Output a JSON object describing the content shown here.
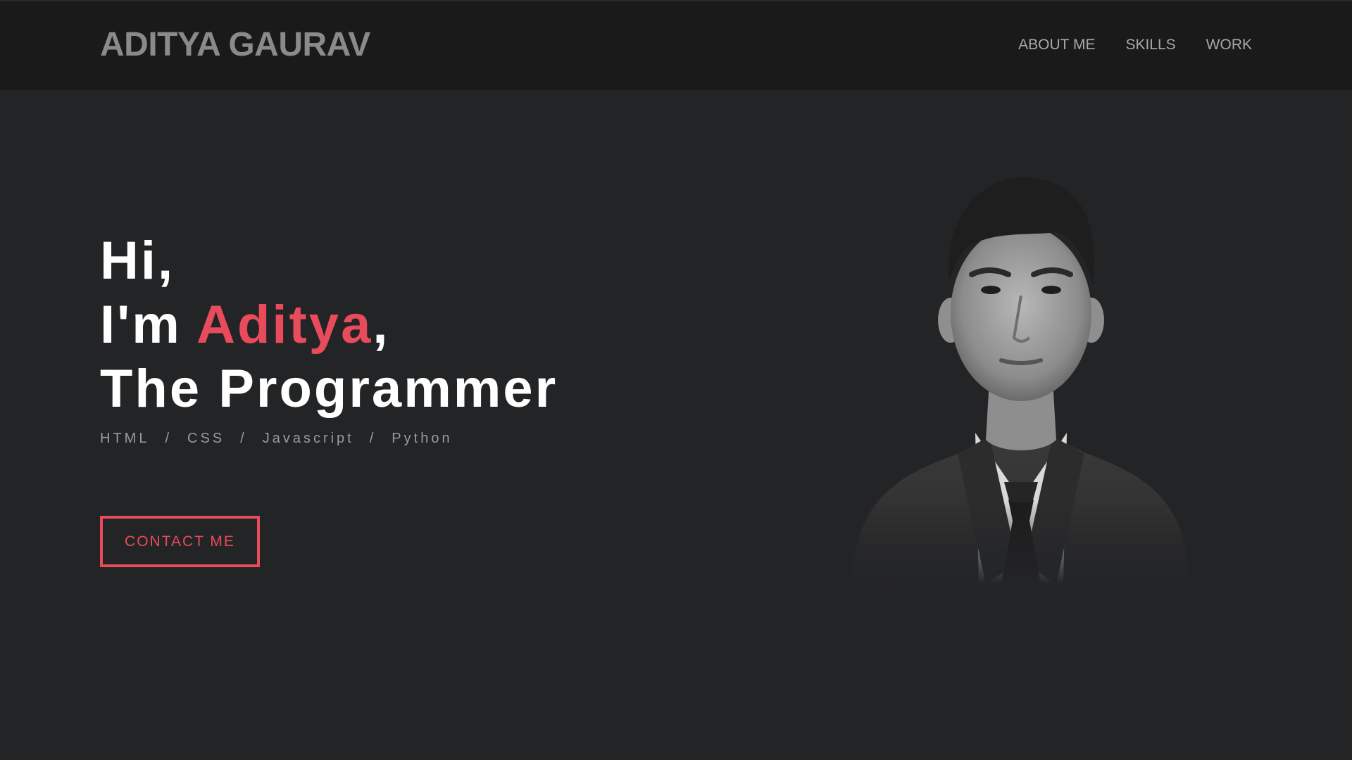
{
  "nav": {
    "brand": "ADITYA GAURAV",
    "links": [
      "ABOUT ME",
      "SKILLS",
      "WORK"
    ]
  },
  "hero": {
    "line1": "Hi,",
    "line2_prefix": "I'm ",
    "line2_name": "Aditya",
    "line2_suffix": ",",
    "line3": "The Programmer",
    "tech": [
      "HTML",
      "CSS",
      "Javascript",
      "Python"
    ],
    "tech_separator": "/",
    "cta_label": "CONTACT ME"
  },
  "portrait": {
    "icon": "person-portrait",
    "description_color": "grayscale"
  },
  "colors": {
    "accent": "#e84b5c",
    "background": "#232426",
    "navbar": "#1a1a1a"
  }
}
